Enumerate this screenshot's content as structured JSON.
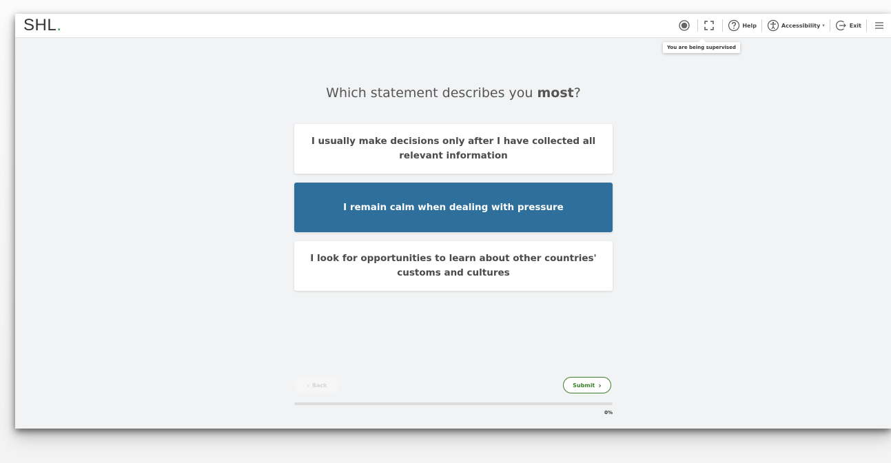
{
  "brand": {
    "name": "SHL",
    "dot": "."
  },
  "toolbar": {
    "help_label": "Help",
    "accessibility_label": "Accessibility",
    "exit_label": "Exit",
    "supervision_tooltip": "You are being supervised",
    "icons": [
      "record-icon",
      "fullscreen-icon",
      "help-icon",
      "accessibility-icon",
      "exit-icon",
      "menu-icon"
    ]
  },
  "question": {
    "prefix": "Which statement describes you ",
    "emphasis": "most",
    "suffix": "?"
  },
  "options": [
    {
      "text": "I usually make decisions only after I have collected all relevant information",
      "selected": false
    },
    {
      "text": "I remain calm when dealing with pressure",
      "selected": true
    },
    {
      "text": "I look for opportunities to learn about other countries' customs and cultures",
      "selected": false
    }
  ],
  "navigation": {
    "back_label": "Back",
    "submit_label": "Submit"
  },
  "progress": {
    "percent": 0,
    "label": "0%"
  },
  "colors": {
    "selected_option": "#2e6f9b",
    "accent_green": "#3a7f2b",
    "brand_dot": "#2e9a4e"
  }
}
